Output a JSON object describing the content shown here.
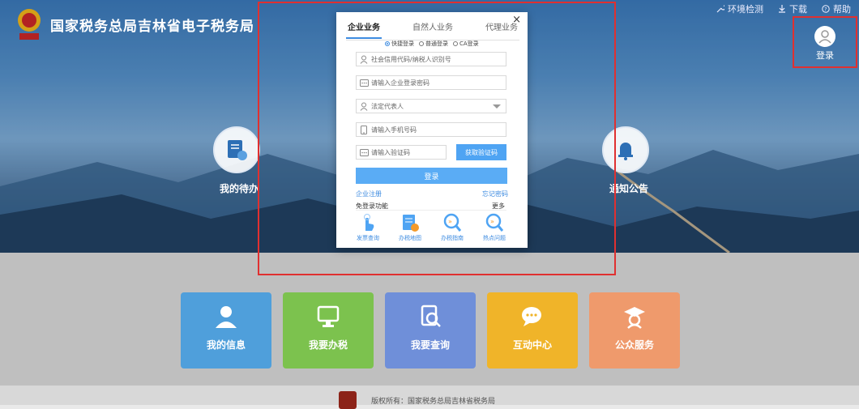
{
  "header": {
    "site_title": "国家税务总局吉林省电子税务局",
    "links": [
      {
        "label": "环境检测",
        "icon": "wrench-icon"
      },
      {
        "label": "下载",
        "icon": "download-icon"
      },
      {
        "label": "帮助",
        "icon": "help-icon"
      }
    ],
    "login_label": "登录"
  },
  "hero": {
    "left_button_label": "我的待办",
    "right_button_label": "通知公告"
  },
  "dialog": {
    "close_glyph": "×",
    "tabs": [
      "企业业务",
      "自然人业务",
      "代理业务"
    ],
    "login_modes": [
      {
        "label": "快捷登录",
        "selected": true
      },
      {
        "label": "普通登录",
        "selected": false
      },
      {
        "label": "CA登录",
        "selected": false
      }
    ],
    "fields": {
      "credit_code_placeholder": "社会信用代码/纳税人识别号",
      "password_placeholder": "请输入企业登录密码",
      "legal_rep_placeholder": "法定代表人",
      "phone_placeholder": "请输入手机号码",
      "code_placeholder": "请输入验证码"
    },
    "get_code_label": "获取验证码",
    "login_button_label": "登录",
    "register_link": "企业注册",
    "forgot_link": "忘记密码",
    "free_section_title": "免登录功能",
    "more_label": "更多",
    "quick_items": [
      {
        "label": "发票查询",
        "icon": "tap-hand-icon"
      },
      {
        "label": "办税地图",
        "icon": "map-document-icon"
      },
      {
        "label": "办税指南",
        "icon": "magnifier-guide-icon"
      },
      {
        "label": "热点问题",
        "icon": "magnifier-question-icon"
      }
    ]
  },
  "tiles": [
    {
      "label": "我的信息",
      "icon": "user-icon",
      "color": "#4f9fdb"
    },
    {
      "label": "我要办税",
      "icon": "monitor-icon",
      "color": "#7cc24e"
    },
    {
      "label": "我要查询",
      "icon": "search-document-icon",
      "color": "#6f8fd9"
    },
    {
      "label": "互动中心",
      "icon": "chat-icon",
      "color": "#f0b429"
    },
    {
      "label": "公众服务",
      "icon": "graduate-icon",
      "color": "#ef9a6c"
    }
  ],
  "footer": {
    "copyright": "版权所有：国家税务总局吉林省税务局"
  },
  "colors": {
    "accent": "#3d8be0",
    "highlight_frame": "#e03030"
  }
}
